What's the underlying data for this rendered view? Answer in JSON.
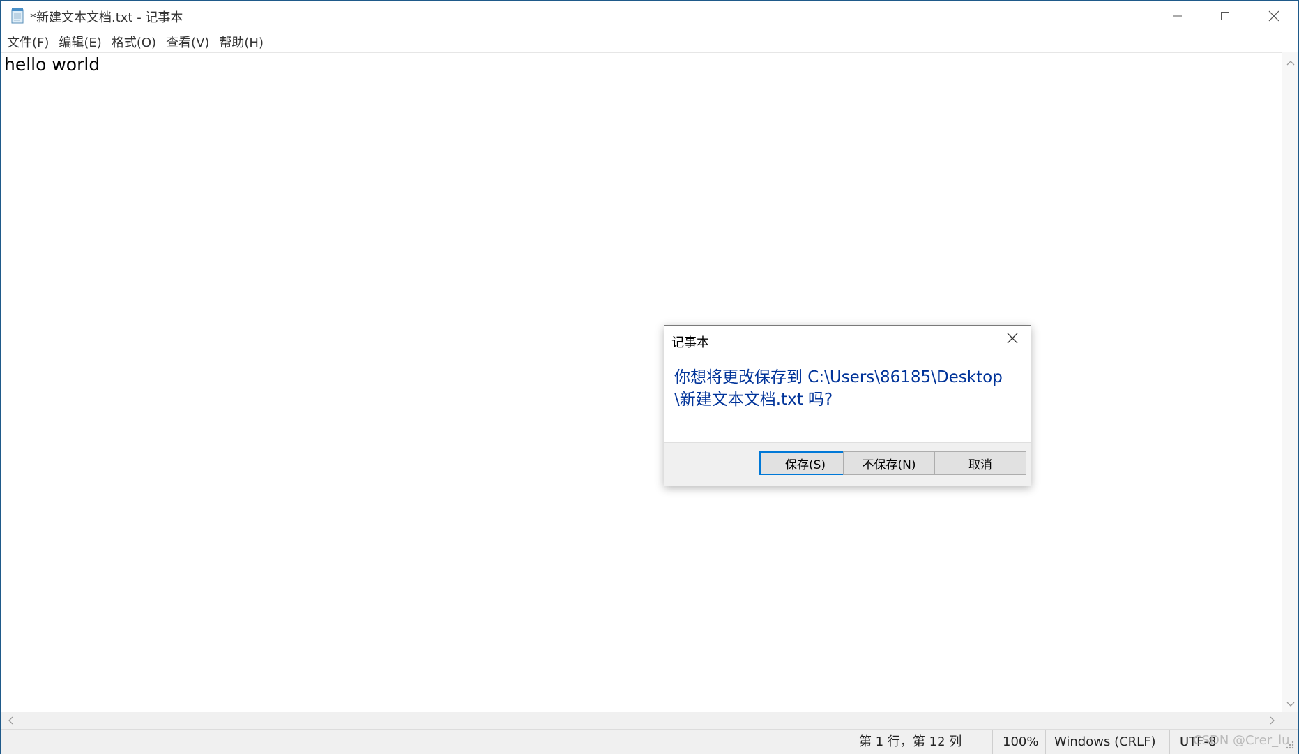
{
  "window": {
    "title": "*新建文本文档.txt - 记事本"
  },
  "menu": {
    "items": [
      "文件(F)",
      "编辑(E)",
      "格式(O)",
      "查看(V)",
      "帮助(H)"
    ]
  },
  "editor": {
    "content": "hello world"
  },
  "dialog": {
    "title": "记事本",
    "message": "你想将更改保存到 C:\\Users\\86185\\Desktop\\新建文本文档.txt 吗?",
    "buttons": {
      "save": "保存(S)",
      "dont_save": "不保存(N)",
      "cancel": "取消"
    }
  },
  "status": {
    "position": "第 1 行，第 12 列",
    "zoom": "100%",
    "line_ending": "Windows (CRLF)",
    "encoding": "UTF-8"
  },
  "watermark": "CSDN @Crer_lu",
  "colors": {
    "dialog_message": "#003399",
    "default_button_border": "#0078d7",
    "window_border": "#1f5a8a"
  },
  "icons": {
    "app": "notepad-icon",
    "minimize": "minimize-icon",
    "maximize": "maximize-icon",
    "close": "close-icon",
    "dialog_close": "close-icon"
  }
}
